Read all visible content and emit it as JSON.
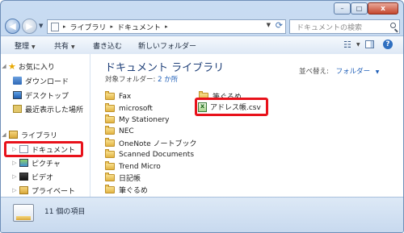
{
  "window": {
    "controls": {
      "minimize": "–",
      "maximize": "□",
      "close": "x"
    }
  },
  "address": {
    "separator": "▸",
    "crumbs": [
      "ライブラリ",
      "ドキュメント"
    ],
    "search_placeholder": "ドキュメントの検索"
  },
  "toolbar": {
    "organize": "整理",
    "share": "共有",
    "burn": "書き込む",
    "new_folder": "新しいフォルダー",
    "help": "?"
  },
  "nav": {
    "favorites": "お気に入り",
    "downloads": "ダウンロード",
    "desktop": "デスクトップ",
    "recent": "最近表示した場所",
    "libraries": "ライブラリ",
    "documents": "ドキュメント",
    "pictures": "ピクチャ",
    "videos": "ビデオ",
    "private": "プライベート"
  },
  "main": {
    "title": "ドキュメント ライブラリ",
    "subtitle_prefix": "対象フォルダー:",
    "subtitle_link": "2 か所",
    "arrange_label": "並べ替え:",
    "arrange_value": "フォルダー",
    "files_col1": [
      "Fax",
      "microsoft",
      "My Stationery",
      "NEC",
      "OneNote ノートブック",
      "Scanned Documents",
      "Trend Micro",
      "日記帳",
      "筆ぐるめ"
    ],
    "files_col2": [
      "筆ぐるめ",
      "アドレス帳.csv"
    ]
  },
  "status": {
    "count_text": "11 個の項目"
  },
  "colors": {
    "highlight": "#e8121b",
    "link": "#1f5fb8",
    "title": "#1e3f78"
  }
}
